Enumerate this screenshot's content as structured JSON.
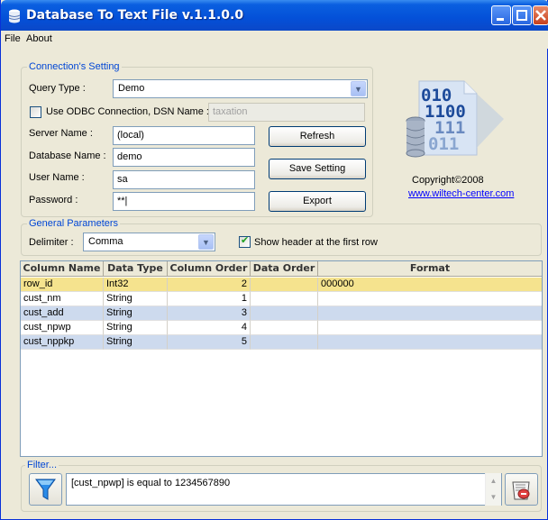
{
  "window": {
    "title": "Database To Text File v.1.1.0.0"
  },
  "menu": [
    "File",
    "About"
  ],
  "connection": {
    "group_label": "Connection's Setting",
    "query_type_label": "Query Type :",
    "query_type_value": "Demo",
    "odbc_label": "Use ODBC Connection, DSN Name :",
    "odbc_checked": false,
    "dsn_value": "taxation",
    "server_label": "Server Name :",
    "server_value": "(local)",
    "database_label": "Database Name :",
    "database_value": "demo",
    "user_label": "User Name :",
    "user_value": "sa",
    "password_label": "Password :",
    "password_value": "**|",
    "refresh_button": "Refresh",
    "save_button": "Save Setting",
    "export_button": "Export"
  },
  "about": {
    "logo_lines": [
      "010",
      "1100",
      "111",
      "011"
    ],
    "copyright": "Copyright©2008",
    "website": "www.wiltech-center.com"
  },
  "general": {
    "group_label": "General Parameters",
    "delimiter_label": "Delimiter :",
    "delimiter_value": "Comma",
    "show_header_label": "Show header at the first row",
    "show_header_checked": true
  },
  "grid": {
    "columns": [
      "Column Name",
      "Data Type",
      "Column Order",
      "Data Order",
      "Format"
    ],
    "rows": [
      [
        "row_id",
        "Int32",
        "2",
        "",
        "000000"
      ],
      [
        "cust_nm",
        "String",
        "1",
        "",
        ""
      ],
      [
        "cust_add",
        "String",
        "3",
        "",
        ""
      ],
      [
        "cust_npwp",
        "String",
        "4",
        "",
        ""
      ],
      [
        "cust_nppkp",
        "String",
        "5",
        "",
        ""
      ]
    ]
  },
  "filter": {
    "group_label": "Filter...",
    "text": "[cust_npwp] is equal to 1234567890"
  }
}
